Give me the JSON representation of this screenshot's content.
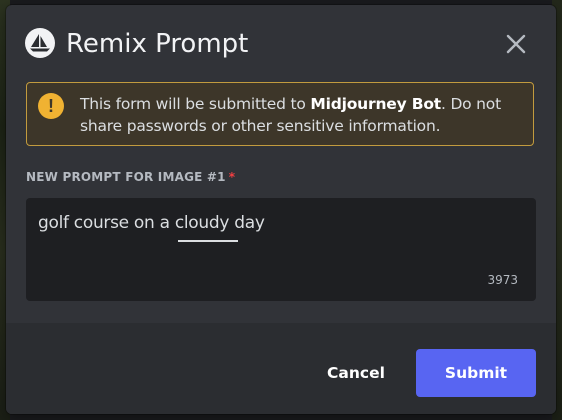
{
  "modal": {
    "title": "Remix Prompt",
    "bot_icon": "sailboat-icon",
    "close_icon": "close-icon"
  },
  "warning": {
    "icon": "exclamation-icon",
    "prefix": "This form will be submitted to ",
    "bot_name": "Midjourney Bot",
    "suffix": ". Do not share passwords or other sensitive information."
  },
  "field": {
    "label": "NEW PROMPT FOR IMAGE #1",
    "required_marker": "*",
    "value": "golf course on a cloudy day",
    "remaining_chars": "3973"
  },
  "footer": {
    "cancel_label": "Cancel",
    "submit_label": "Submit"
  },
  "colors": {
    "accent": "#5865f2",
    "warning_border": "#c29b3e",
    "warning_icon": "#f0b232",
    "required": "#f23f42",
    "modal_bg": "#313338",
    "footer_bg": "#2b2d31",
    "input_bg": "#1e1f22"
  }
}
